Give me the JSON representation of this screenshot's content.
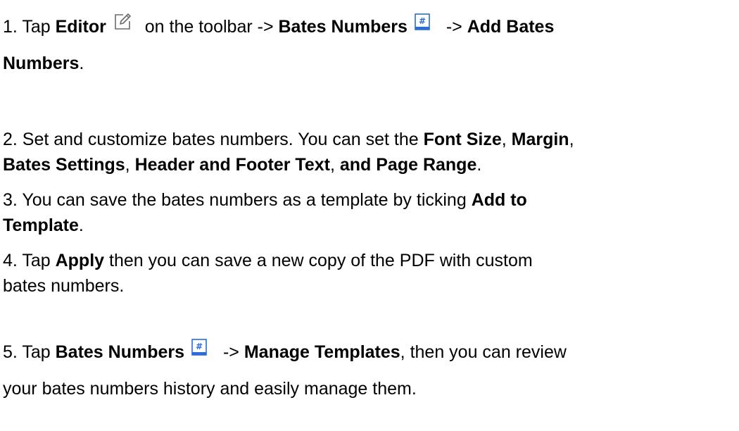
{
  "step1": {
    "prefix": "1. Tap ",
    "editor": "Editor",
    "mid1": " on the toolbar -> ",
    "bates_numbers": "Bates Numbers",
    "mid2": " -> ",
    "add_bates": "Add Bates",
    "numbers_word": "Numbers",
    "end": "."
  },
  "step2": {
    "line1_prefix": "2. Set and customize bates numbers. You can set the ",
    "font_size": "Font Size",
    "comma1": ", ",
    "margin": "Margin",
    "comma2": ",",
    "bates_settings": "Bates Settings",
    "comma3": ", ",
    "header_footer": "Header and Footer Text",
    "comma4": ", ",
    "and_page_range": "and Page Range",
    "end": "."
  },
  "step3": {
    "line1_prefix": "3. You can save the bates numbers as a template by ticking ",
    "add_to": "Add to",
    "template": "Template",
    "end": "."
  },
  "step4": {
    "prefix": "4. Tap ",
    "apply": "Apply",
    "line1_suffix": " then you can save a new copy of the PDF with custom",
    "line2": "bates numbers."
  },
  "step5": {
    "prefix": "5. Tap ",
    "bates_numbers": "Bates Numbers",
    "mid": " -> ",
    "manage_templates": "Manage Templates",
    "line1_suffix": ", then you can review",
    "line2": "your bates numbers history and easily manage them."
  },
  "icons": {
    "edit": "edit-icon",
    "bates": "bates-numbers-icon",
    "bates_color": "#2b6cd9"
  }
}
